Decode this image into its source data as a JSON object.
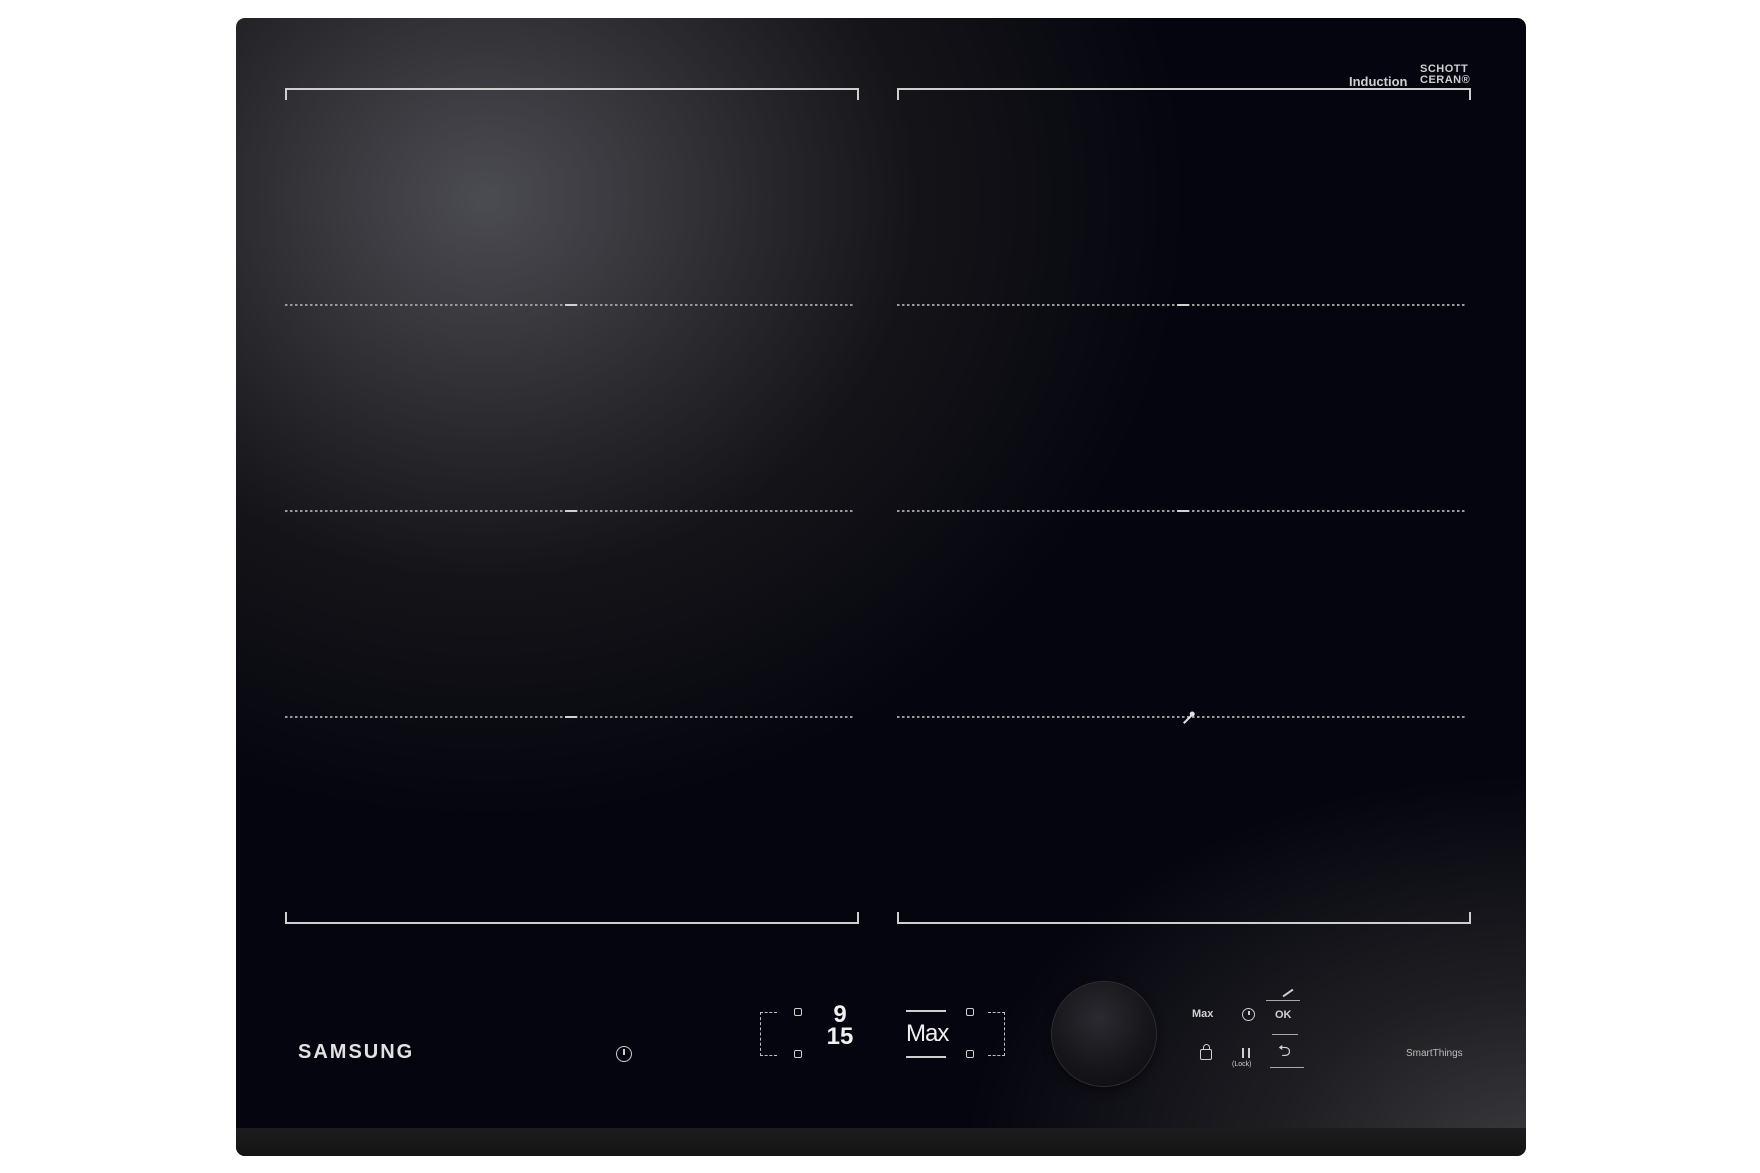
{
  "branding": {
    "induction_label": "Induction",
    "schott_line1": "SCHOTT",
    "schott_line2": "CERAN®",
    "samsung_logo": "SAMSUNG",
    "smartthings_label": "SmartThings"
  },
  "display": {
    "timer_hours": "9",
    "timer_minutes": "15",
    "power_level": "Max"
  },
  "controls": {
    "max_label": "Max",
    "ok_label": "OK",
    "pause_sub_label": "(Lock)",
    "back_glyph": "⮌"
  },
  "icons": {
    "power": "power-icon",
    "timer": "timer-icon",
    "lock": "lock-icon",
    "pause": "pause-icon",
    "back": "back-icon",
    "probe": "probe-icon"
  },
  "colors": {
    "glass": "#05050f",
    "print": "#cfcfcf"
  }
}
